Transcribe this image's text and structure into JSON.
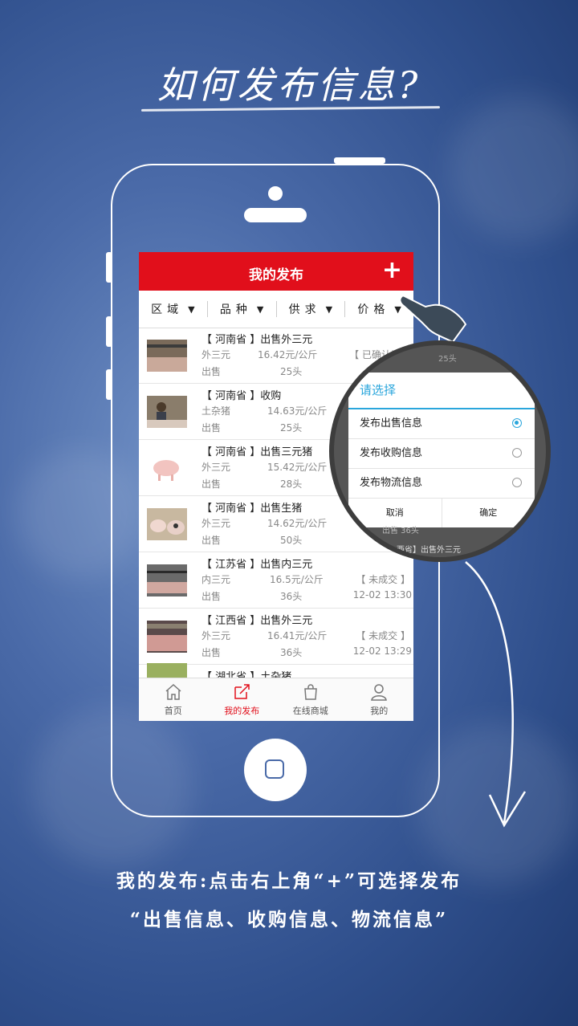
{
  "headline": "如何发布信息?",
  "app": {
    "title": "我的发布",
    "add_label": "+",
    "filters": [
      "区域",
      "品种",
      "供求",
      "价格"
    ],
    "rows": [
      {
        "title": "【 河南省 】出售外三元",
        "breed": "外三元",
        "price": "16.42元/公斤",
        "status": "【 已确认订单",
        "type": "出售",
        "count": "25头",
        "time": ""
      },
      {
        "title": "【 河南省 】收购",
        "breed": "土杂猪",
        "price": "14.63元/公斤",
        "status": "",
        "type": "出售",
        "count": "25头",
        "time": ""
      },
      {
        "title": "【 河南省 】出售三元猪",
        "breed": "外三元",
        "price": "15.42元/公斤",
        "status": "",
        "type": "出售",
        "count": "28头",
        "time": ""
      },
      {
        "title": "【 河南省 】出售生猪",
        "breed": "外三元",
        "price": "14.62元/公斤",
        "status": "",
        "type": "出售",
        "count": "50头",
        "time": "12-0"
      },
      {
        "title": "【 江苏省 】出售内三元",
        "breed": "内三元",
        "price": "16.5元/公斤",
        "status": "【 未成交 】",
        "type": "出售",
        "count": "36头",
        "time": "12-02 13:30"
      },
      {
        "title": "【 江西省 】出售外三元",
        "breed": "外三元",
        "price": "16.41元/公斤",
        "status": "【 未成交 】",
        "type": "出售",
        "count": "36头",
        "time": "12-02 13:29"
      },
      {
        "title": "【 湖北省 】土杂猪",
        "breed": "",
        "price": "",
        "status": "",
        "type": "",
        "count": "",
        "time": ""
      }
    ],
    "tabs": [
      {
        "label": "首页",
        "icon": "home-icon"
      },
      {
        "label": "我的发布",
        "icon": "publish-icon"
      },
      {
        "label": "在线商城",
        "icon": "shop-bag-icon"
      },
      {
        "label": "我的",
        "icon": "user-icon"
      }
    ]
  },
  "dialog": {
    "title": "请选择",
    "options": [
      "发布出售信息",
      "发布收购信息",
      "发布物流信息"
    ],
    "selected_index": 0,
    "cancel": "取消",
    "confirm": "确定",
    "peek_top": "25头",
    "peek_bottom": "出售          36头",
    "peek_bottom2": "西省】出售外三元"
  },
  "caption": {
    "line1": "我的发布:点击右上角“+”可选择发布",
    "line2": "“出售信息、收购信息、物流信息”"
  },
  "colors": {
    "brand_red": "#e10f1b",
    "dialog_blue": "#2aa6dc"
  }
}
